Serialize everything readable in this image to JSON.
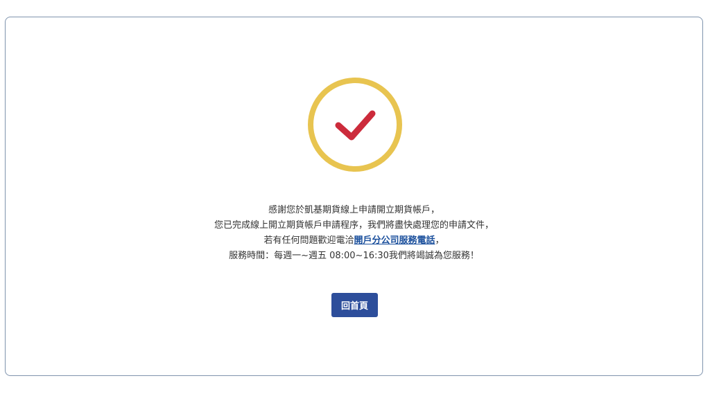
{
  "icon": {
    "name": "check-circle-icon",
    "ring_color": "#e8c450",
    "check_color": "#cc2b3b"
  },
  "message": {
    "line1": "感謝您於凱基期貨線上申請開立期貨帳戶，",
    "line2": "您已完成線上開立期貨帳戶申請程序，我們將盡快處理您的申請文件，",
    "line3_prefix": "若有任何問題歡迎電洽",
    "line3_link": "開戶分公司服務電話",
    "line3_suffix": "，",
    "line4": "服務時間：每週一~週五 08:00~16:30我們將竭誠為您服務！"
  },
  "home_button": {
    "label": "回首頁",
    "color": "#2d4e9b"
  }
}
